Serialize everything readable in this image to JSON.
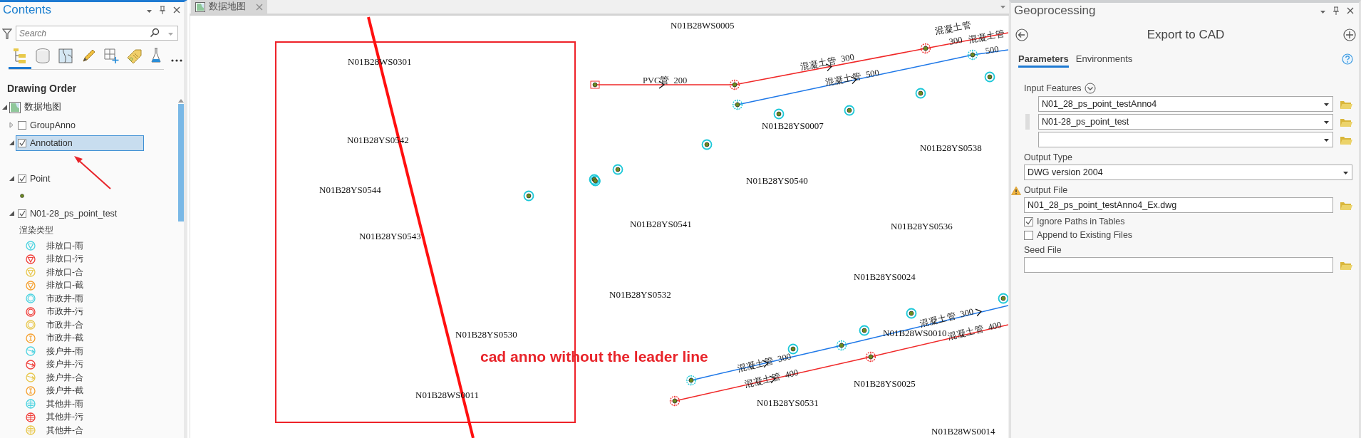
{
  "contents": {
    "title": "Contents",
    "search": {
      "placeholder": "Search"
    },
    "view_tabs": [
      {
        "selected": true
      },
      {
        "selected": false
      },
      {
        "selected": false
      },
      {
        "selected": false
      },
      {
        "selected": false
      },
      {
        "selected": false
      },
      {
        "selected": false
      }
    ],
    "heading": "Drawing Order",
    "layers": [
      {
        "label": "数据地图",
        "kind": "map",
        "expanded": true,
        "selected": false,
        "children": [
          {
            "label": "GroupAnno",
            "kind": "group",
            "checked": false,
            "expanded": false,
            "selected": false
          },
          {
            "label": "Annotation",
            "kind": "annotation",
            "checked": true,
            "expanded": true,
            "selected": true
          },
          {
            "label": "Point",
            "kind": "point",
            "checked": true,
            "expanded": true,
            "selected": false
          },
          {
            "label": "N01-28_ps_point_test",
            "kind": "unique_values",
            "checked": true,
            "expanded": true,
            "selected": false,
            "legend_heading": "渲染类型",
            "legend": [
              {
                "label": "排放口-雨",
                "kind": "outlet",
                "color": "#4fd3e0"
              },
              {
                "label": "排放口-污",
                "kind": "outlet",
                "color": "#f0403c"
              },
              {
                "label": "排放口-合",
                "kind": "outlet",
                "color": "#e8c850"
              },
              {
                "label": "排放口-截",
                "kind": "outlet",
                "color": "#f5a030"
              },
              {
                "label": "市政井-雨",
                "kind": "ring",
                "color": "#4fd3e0"
              },
              {
                "label": "市政井-污",
                "kind": "ring",
                "color": "#f0403c"
              },
              {
                "label": "市政井-合",
                "kind": "ring",
                "color": "#e8c850"
              },
              {
                "label": "市政井-截",
                "kind": "bar",
                "color": "#f5a030"
              },
              {
                "label": "接户井-雨",
                "kind": "arrow",
                "color": "#4fd3e0"
              },
              {
                "label": "接户井-污",
                "kind": "arrow",
                "color": "#f0403c"
              },
              {
                "label": "接户井-合",
                "kind": "arrow",
                "color": "#e8c850"
              },
              {
                "label": "接户井-截",
                "kind": "bar",
                "color": "#f5a030"
              },
              {
                "label": "其他井-雨",
                "kind": "cross",
                "color": "#4fd3e0"
              },
              {
                "label": "其他井-污",
                "kind": "cross",
                "color": "#f0403c"
              },
              {
                "label": "其他井-合",
                "kind": "cross",
                "color": "#e8c850"
              }
            ]
          }
        ]
      }
    ]
  },
  "map": {
    "tab": {
      "label": "数据地图",
      "selected": true
    },
    "labels": [
      "N01B28WS0005",
      "N01B28WS0301",
      "N01B28YS0007",
      "N01B28YS0542",
      "N01B28YS0538",
      "N01B28YS0544",
      "N01B28YS0540",
      "N01B28YS0541",
      "N01B28YS0536",
      "N01B28YS0543",
      "N01B28YS0024",
      "N01B28YS0532",
      "N01B28WS0010",
      "N01B28YS0530",
      "N01B28YS0025",
      "N01B28WS0011",
      "N01B28YS0531",
      "N01B28WS0014"
    ],
    "pipe_labels": [
      "PVC管  200",
      "混凝土管  300",
      "混凝土管  500",
      "混凝土管",
      "300",
      "混凝土管",
      "500",
      "混凝土管  300",
      "混凝土管  400",
      "混凝土管  300",
      "混凝土管  400"
    ],
    "callout": "cad anno without the leader line"
  },
  "geoprocessing": {
    "title": "Geoprocessing",
    "tool_title": "Export to CAD",
    "tabs": [
      {
        "label": "Parameters",
        "selected": true
      },
      {
        "label": "Environments",
        "selected": false
      }
    ],
    "parameters": [
      {
        "kind": "multi",
        "label": "Input Features",
        "values": [
          {
            "value": "N01_28_ps_point_testAnno4",
            "active": false
          },
          {
            "value": "N01-28_ps_point_test",
            "active": true
          }
        ]
      },
      {
        "kind": "dropdown",
        "label": "Output Type",
        "value": "DWG version 2004"
      },
      {
        "kind": "file",
        "label": "Output File",
        "value": "N01_28_ps_point_testAnno4_Ex.dwg",
        "warning": true
      },
      {
        "kind": "checkbox",
        "label": "Ignore Paths in Tables",
        "checked": true
      },
      {
        "kind": "checkbox",
        "label": "Append to Existing Files",
        "checked": false
      },
      {
        "kind": "file",
        "label": "Seed File",
        "warning": false
      }
    ]
  }
}
